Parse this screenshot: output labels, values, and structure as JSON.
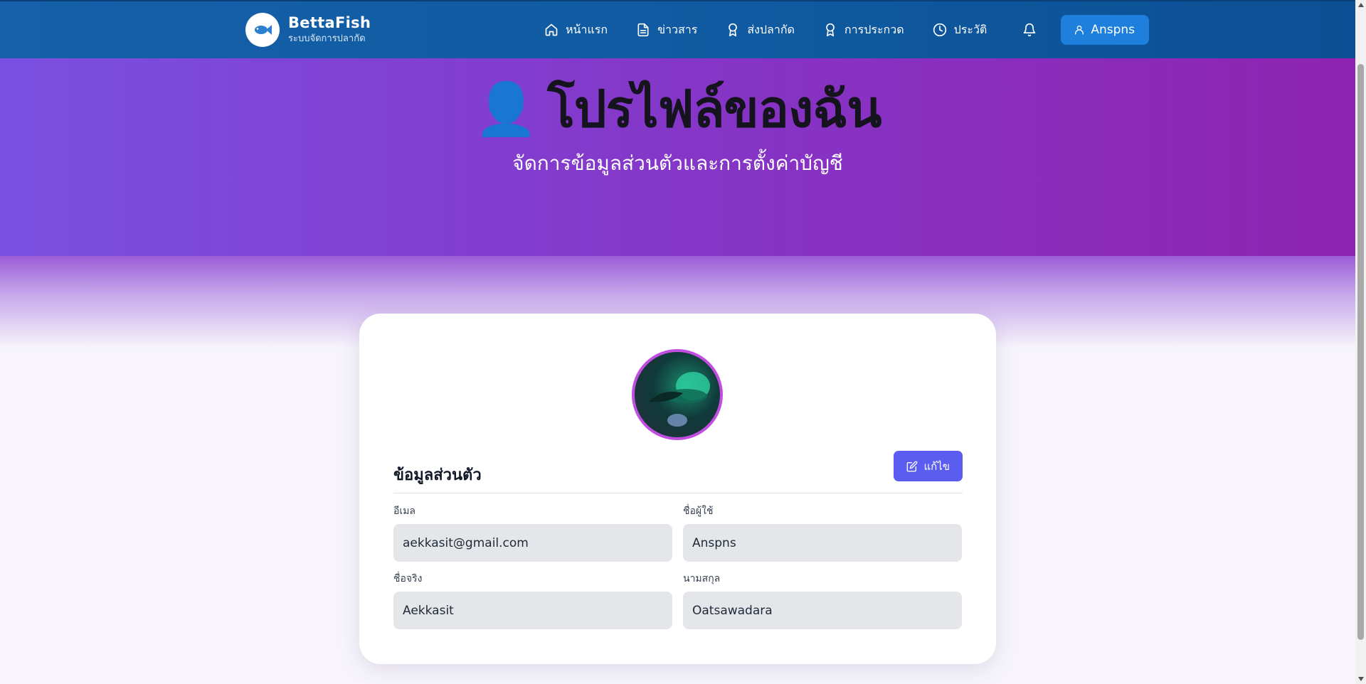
{
  "brand": {
    "title": "BettaFish",
    "subtitle": "ระบบจัดการปลากัด",
    "icon": "fish-icon"
  },
  "nav": {
    "items": [
      {
        "label": "หน้าแรก",
        "icon": "home-icon"
      },
      {
        "label": "ข่าวสาร",
        "icon": "document-icon"
      },
      {
        "label": "ส่งปลากัด",
        "icon": "award-icon"
      },
      {
        "label": "การประกวด",
        "icon": "award-icon"
      },
      {
        "label": "ประวัติ",
        "icon": "clock-icon"
      }
    ],
    "bell_icon": "bell-icon",
    "user_label": "Anspns"
  },
  "hero": {
    "emoji": "👤",
    "title": "โปรไฟล์ของฉัน",
    "subtitle": "จัดการข้อมูลส่วนตัวและการตั้งค่าบัญชี"
  },
  "profile": {
    "section_title": "ข้อมูลส่วนตัว",
    "edit_label": "แก้ไข",
    "fields": {
      "email": {
        "label": "อีเมล",
        "value": "aekkasit@gmail.com"
      },
      "username": {
        "label": "ชื่อผู้ใช้",
        "value": "Anspns"
      },
      "firstname": {
        "label": "ชื่อจริง",
        "value": "Aekkasit"
      },
      "lastname": {
        "label": "นามสกุล",
        "value": "Oatsawadara"
      }
    }
  },
  "colors": {
    "navbar": "#1560a8",
    "hero_start": "#7a50e0",
    "hero_end": "#8e24b0",
    "user_button": "#1e7fdc",
    "edit_button": "#5b5cf0",
    "avatar_border": "#c04ee0"
  }
}
